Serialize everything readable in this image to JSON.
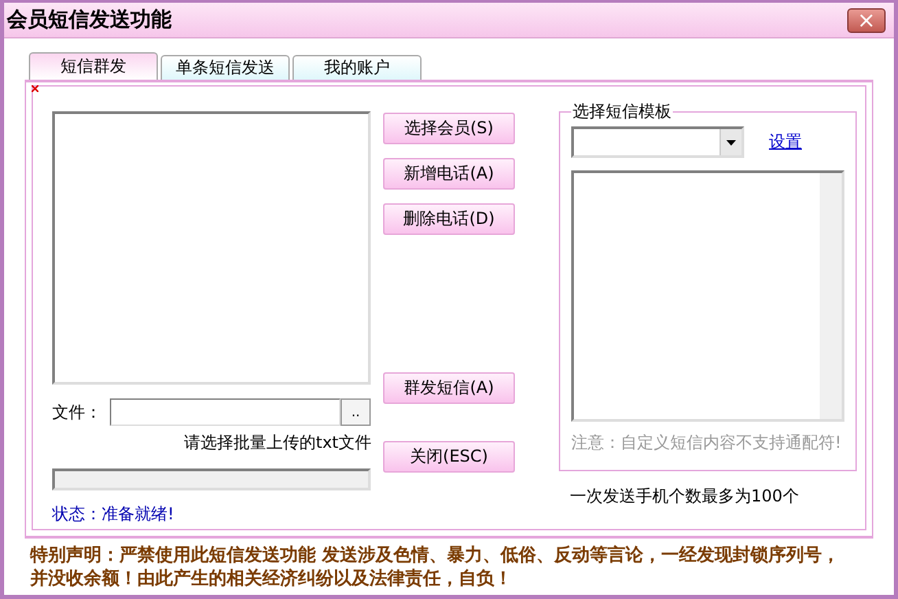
{
  "window": {
    "title": "会员短信发送功能",
    "close": "×"
  },
  "tabs": [
    {
      "label": "短信群发",
      "selected": true
    },
    {
      "label": "单条短信发送",
      "selected": false
    },
    {
      "label": "我的账户",
      "selected": false
    }
  ],
  "buttons": [
    {
      "label": "选择会员(S)",
      "kind": "top"
    },
    {
      "label": "新增电话(A)",
      "kind": "top"
    },
    {
      "label": "删除电话(D)",
      "kind": "top"
    },
    {
      "label": "群发短信(A)",
      "kind": "bottom"
    },
    {
      "label": "关闭(ESC)",
      "kind": "bottom"
    }
  ],
  "file": {
    "label": "文件：",
    "browse": "..",
    "hint": "请选择批量上传的txt文件"
  },
  "progress": {
    "level": 0
  },
  "status": "状态：准备就绪!",
  "template": {
    "title": "选择短信模板",
    "link": "设置",
    "note": "注意：自定义短信内容不支持通配符!"
  },
  "limit_note": "一次发送手机个数最多为100个",
  "disclaimer": "特别声明：严禁使用此短信发送功能 发送涉及色情、暴力、低俗、反动等言论，一经发现封锁序列号，并没收余额！由此产生的相关经济纠纷以及法律责任，自负！"
}
